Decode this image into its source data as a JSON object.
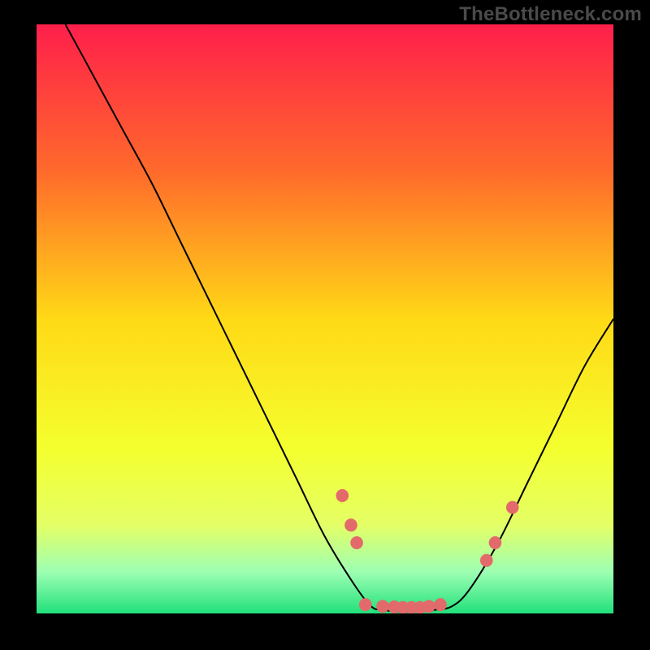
{
  "watermark": "TheBottleneck.com",
  "chart_data": {
    "type": "line",
    "title": "",
    "xlabel": "",
    "ylabel": "",
    "xlim": [
      0,
      100
    ],
    "ylim": [
      0,
      100
    ],
    "gradient_stops": [
      {
        "offset": 0,
        "color": "#ff1f4b"
      },
      {
        "offset": 25,
        "color": "#ff6a2b"
      },
      {
        "offset": 50,
        "color": "#ffd916"
      },
      {
        "offset": 72,
        "color": "#f4ff2e"
      },
      {
        "offset": 85,
        "color": "#e4ff66"
      },
      {
        "offset": 93,
        "color": "#9dffb3"
      },
      {
        "offset": 100,
        "color": "#21e07b"
      }
    ],
    "curve": [
      {
        "x": 5,
        "y": 100
      },
      {
        "x": 10,
        "y": 91
      },
      {
        "x": 15,
        "y": 82
      },
      {
        "x": 20,
        "y": 73
      },
      {
        "x": 25,
        "y": 63
      },
      {
        "x": 30,
        "y": 53
      },
      {
        "x": 35,
        "y": 43
      },
      {
        "x": 40,
        "y": 33
      },
      {
        "x": 45,
        "y": 23
      },
      {
        "x": 50,
        "y": 13
      },
      {
        "x": 55,
        "y": 5
      },
      {
        "x": 58,
        "y": 1.2
      },
      {
        "x": 60,
        "y": 0.6
      },
      {
        "x": 63,
        "y": 0.3
      },
      {
        "x": 66,
        "y": 0.3
      },
      {
        "x": 69,
        "y": 0.6
      },
      {
        "x": 72,
        "y": 1.2
      },
      {
        "x": 75,
        "y": 4
      },
      {
        "x": 80,
        "y": 12
      },
      {
        "x": 85,
        "y": 22
      },
      {
        "x": 90,
        "y": 32
      },
      {
        "x": 95,
        "y": 42
      },
      {
        "x": 100,
        "y": 50
      }
    ],
    "markers": [
      {
        "x": 53,
        "y": 20
      },
      {
        "x": 54.5,
        "y": 15
      },
      {
        "x": 55.5,
        "y": 12
      },
      {
        "x": 57,
        "y": 1.5
      },
      {
        "x": 60,
        "y": 1.2
      },
      {
        "x": 62,
        "y": 1.1
      },
      {
        "x": 63.5,
        "y": 1.0
      },
      {
        "x": 65,
        "y": 1.0
      },
      {
        "x": 66.5,
        "y": 1.0
      },
      {
        "x": 68,
        "y": 1.2
      },
      {
        "x": 70,
        "y": 1.5
      },
      {
        "x": 78,
        "y": 9
      },
      {
        "x": 79.5,
        "y": 12
      },
      {
        "x": 82.5,
        "y": 18
      }
    ],
    "marker_color": "#e36a6a",
    "marker_radius": 1.1
  }
}
